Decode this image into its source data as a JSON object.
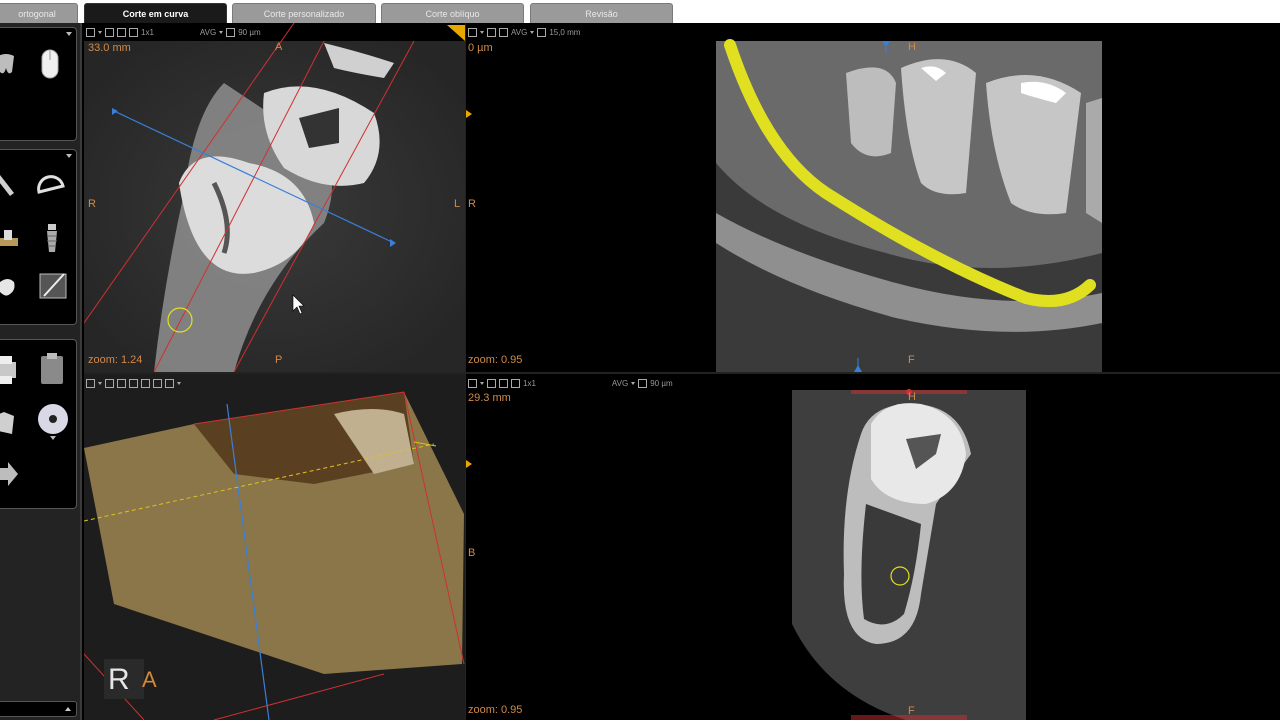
{
  "tabs": [
    {
      "label": "ortogonal",
      "active": false
    },
    {
      "label": "Corte em curva",
      "active": true
    },
    {
      "label": "Corte personalizado",
      "active": false
    },
    {
      "label": "Corte oblíquo",
      "active": false
    },
    {
      "label": "Revisão",
      "active": false
    }
  ],
  "viewports": {
    "axial": {
      "toolbar": {
        "layout": "1x1",
        "mode": "AVG",
        "thickness": "90 µm"
      },
      "distance": "33.0 mm",
      "zoom": "zoom: 1.24",
      "orient": {
        "top": "A",
        "bottom": "P",
        "left": "R",
        "right": "L"
      }
    },
    "panoramic": {
      "toolbar": {
        "mode": "AVG",
        "thickness": "15,0 mm"
      },
      "distance": "0 µm",
      "zoom": "zoom: 0.95",
      "orient": {
        "top": "H",
        "bottom": "F",
        "left": "R"
      }
    },
    "volume3d": {
      "badge": "R",
      "badge_side": "A"
    },
    "cross": {
      "toolbar": {
        "layout": "1x1",
        "mode": "AVG",
        "thickness": "90 µm"
      },
      "distance": "29.3 mm",
      "zoom": "zoom: 0.95",
      "orient": {
        "top": "H",
        "bottom": "F",
        "left": "B"
      }
    }
  },
  "colors": {
    "orientation_label": "#d08a4a",
    "nerve_canal": "#e0e020",
    "cut_line": "#3a7fd8",
    "slab_line": "#d03030",
    "active_marker": "#e8a800"
  },
  "sidebar_icons": [
    "molar-icon",
    "mouse-icon",
    "ruler-icon",
    "protractor-icon",
    "crown-icon",
    "implant-icon",
    "tooth-icon",
    "edit-icon",
    "printer-icon",
    "clipboard-icon",
    "folder-icon",
    "cd-icon",
    "export-icon"
  ]
}
